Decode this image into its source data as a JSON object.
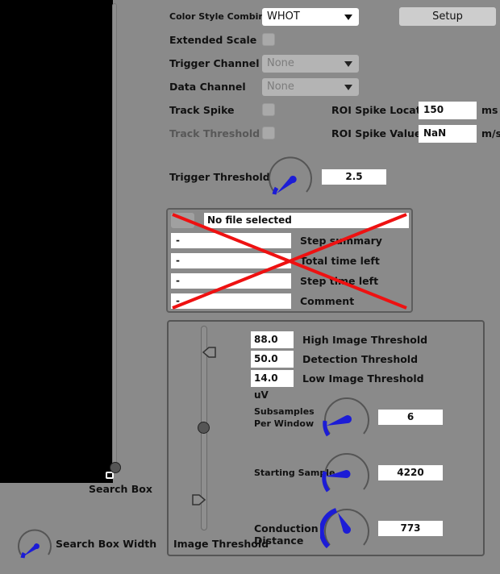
{
  "header": {
    "color_style_label": "Color Style Combination",
    "color_style_value": "WHOT",
    "setup_button": "Setup"
  },
  "settings": {
    "extended_scale_label": "Extended Scale",
    "trigger_channel_label": "Trigger Channel",
    "trigger_channel_value": "None",
    "data_channel_label": "Data Channel",
    "data_channel_value": "None",
    "track_spike_label": "Track Spike",
    "track_threshold_label": "Track Threshold",
    "roi_spike_location_label": "ROI Spike Location",
    "roi_spike_location_value": "150",
    "roi_spike_location_unit": "ms",
    "roi_spike_value_label": "ROI Spike Value",
    "roi_spike_value_value": "NaN",
    "roi_spike_value_unit": "m/s",
    "trigger_threshold_label": "Trigger Threshold",
    "trigger_threshold_value": "2.5"
  },
  "protocol": {
    "file_name": "No file selected",
    "step_summary_value": "-",
    "step_summary_label": "Step summary",
    "total_time_value": "-",
    "total_time_label": "Total time left",
    "step_time_value": "-",
    "step_time_label": "Step time left",
    "comment_value": "-",
    "comment_label": "Comment"
  },
  "image_threshold": {
    "panel_label": "Image Threshold",
    "high_value": "88.0 uV",
    "high_label": "High Image Threshold",
    "detection_value": "50.0 uV",
    "detection_label": "Detection Threshold",
    "low_value": "14.0 uV",
    "low_label": "Low Image Threshold",
    "subsamples_label_1": "Subsamples",
    "subsamples_label_2": "Per Window",
    "subsamples_value": "6",
    "starting_sample_label": "Starting Sample",
    "starting_sample_value": "4220",
    "conduction_label_1": "Conduction",
    "conduction_label_2": "Distance",
    "conduction_value": "773"
  },
  "left": {
    "search_box_label": "Search Box",
    "search_box_width_label": "Search Box Width"
  },
  "colors": {
    "accent_blue": "#1c1cd6",
    "cross_red": "#ee1111",
    "panel_bg": "#8a8a8a"
  }
}
